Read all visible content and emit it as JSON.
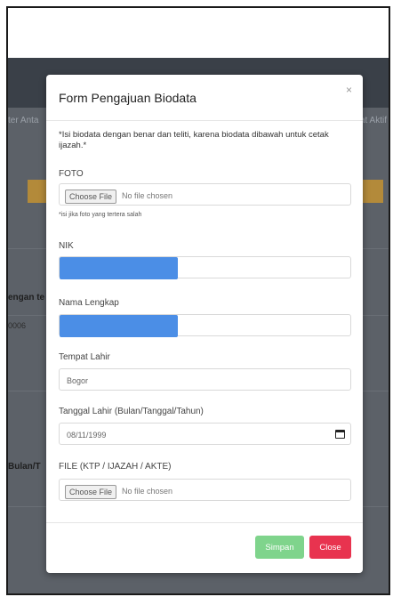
{
  "background": {
    "nav_left": "ter Anta",
    "nav_right": "at Aktif",
    "row_text_1": "engan te",
    "row_text_2": "0006",
    "row_text_3": "Bulan/T"
  },
  "modal": {
    "title": "Form Pengajuan Biodata",
    "close_symbol": "×",
    "notice": "*Isi biodata dengan benar dan teliti, karena biodata dibawah untuk cetak ijazah.*",
    "foto": {
      "label": "FOTO",
      "button": "Choose File",
      "status": "No file chosen",
      "hint": "*isi jika foto yang tertera salah"
    },
    "nik": {
      "label": "NIK",
      "value_redacted": true
    },
    "nama": {
      "label": "Nama Lengkap",
      "value_redacted": true
    },
    "tempat_lahir": {
      "label": "Tempat Lahir",
      "value": "Bogor"
    },
    "tanggal_lahir": {
      "label": "Tanggal Lahir (Bulan/Tanggal/Tahun)",
      "value": "08/11/1999"
    },
    "file_doc": {
      "label": "FILE (KTP / IJAZAH / AKTE)",
      "button": "Choose File",
      "status": "No file chosen"
    },
    "save_label": "Simpan",
    "close_label": "Close"
  },
  "colors": {
    "redaction": "#4b8ee6",
    "save_button": "#7fd48c",
    "close_button": "#e8334f"
  }
}
